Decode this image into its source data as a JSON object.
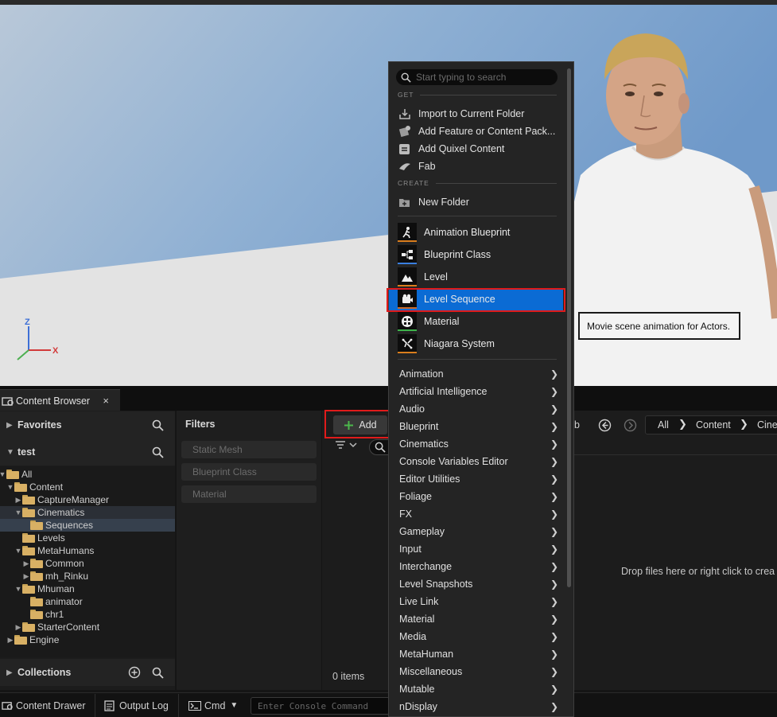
{
  "viewport": {
    "axis_z": "Z",
    "axis_x": "X"
  },
  "content_browser_tab": {
    "label": "Content Browser",
    "close": "×"
  },
  "left_panel": {
    "favorites": "Favorites",
    "project": "test",
    "collections": "Collections",
    "tree": [
      {
        "label": "All",
        "depth": 0,
        "arrow": "▼"
      },
      {
        "label": "Content",
        "depth": 1,
        "arrow": "▼"
      },
      {
        "label": "CaptureManager",
        "depth": 2,
        "arrow": "▶"
      },
      {
        "label": "Cinematics",
        "depth": 2,
        "arrow": "▼"
      },
      {
        "label": "Sequences",
        "depth": 3,
        "arrow": ""
      },
      {
        "label": "Levels",
        "depth": 2,
        "arrow": ""
      },
      {
        "label": "MetaHumans",
        "depth": 2,
        "arrow": "▼"
      },
      {
        "label": "Common",
        "depth": 3,
        "arrow": "▶"
      },
      {
        "label": "mh_Rinku",
        "depth": 3,
        "arrow": "▶"
      },
      {
        "label": "Mhuman",
        "depth": 2,
        "arrow": "▼"
      },
      {
        "label": "animator",
        "depth": 3,
        "arrow": ""
      },
      {
        "label": "chr1",
        "depth": 3,
        "arrow": ""
      },
      {
        "label": "StarterContent",
        "depth": 2,
        "arrow": "▶"
      },
      {
        "label": "Engine",
        "depth": 1,
        "arrow": "▶"
      }
    ]
  },
  "filters": {
    "title": "Filters",
    "items": [
      "Static Mesh",
      "Blueprint Class",
      "Material"
    ]
  },
  "center": {
    "add_label": "Add",
    "items_count": "0 items",
    "drop_text": "Drop files here or right click to crea",
    "path_partial": "b",
    "path": [
      "All",
      "Content",
      "Cine"
    ]
  },
  "menu": {
    "search_placeholder": "Start typing to search",
    "get_header": "GET",
    "get_items": [
      "Import to Current Folder",
      "Add Feature or Content Pack...",
      "Add Quixel Content",
      "Fab"
    ],
    "create_header": "CREATE",
    "new_folder": "New Folder",
    "assets": [
      {
        "label": "Animation Blueprint",
        "accent": "#d97d1d"
      },
      {
        "label": "Blueprint Class",
        "accent": "#3a7fe0"
      },
      {
        "label": "Level",
        "accent": "#d97d1d"
      },
      {
        "label": "Level Sequence",
        "accent": "#c96a2a"
      },
      {
        "label": "Material",
        "accent": "#3db34a"
      },
      {
        "label": "Niagara System",
        "accent": "#d97d1d"
      }
    ],
    "categories": [
      "Animation",
      "Artificial Intelligence",
      "Audio",
      "Blueprint",
      "Cinematics",
      "Console Variables Editor",
      "Editor Utilities",
      "Foliage",
      "FX",
      "Gameplay",
      "Input",
      "Interchange",
      "Level Snapshots",
      "Live Link",
      "Material",
      "Media",
      "MetaHuman",
      "Miscellaneous",
      "Mutable",
      "nDisplay"
    ]
  },
  "tooltip": "Movie scene animation for Actors.",
  "bottom_bar": {
    "content_drawer": "Content Drawer",
    "output_log": "Output Log",
    "cmd": "Cmd",
    "console_placeholder": "Enter Console Command"
  },
  "colors": {
    "highlight": "#0b6bd4",
    "callout": "#e01b1b",
    "folder": "#d8b064",
    "add_plus": "#4cb84c"
  }
}
